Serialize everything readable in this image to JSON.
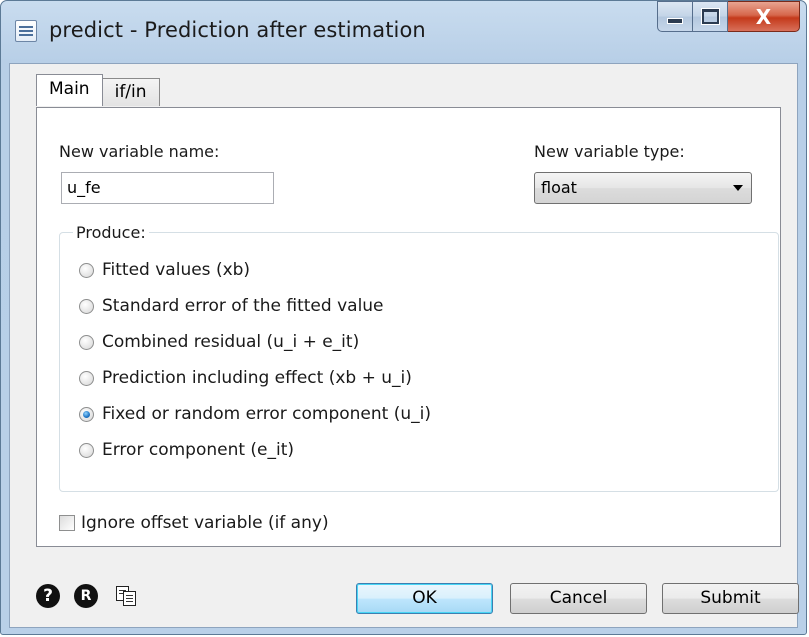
{
  "window": {
    "title": "predict - Prediction after estimation",
    "close_glyph": "X"
  },
  "tabs": [
    {
      "label": "Main",
      "active": true
    },
    {
      "label": "if/in",
      "active": false
    }
  ],
  "main": {
    "new_var_name_label": "New variable name:",
    "new_var_name_value": "u_fe",
    "new_var_type_label": "New variable type:",
    "new_var_type_value": "float",
    "produce_label": "Produce:",
    "options": [
      {
        "label": "Fitted values (xb)",
        "checked": false
      },
      {
        "label": "Standard error of the fitted value",
        "checked": false
      },
      {
        "label": "Combined residual (u_i + e_it)",
        "checked": false
      },
      {
        "label": "Prediction including effect (xb + u_i)",
        "checked": false
      },
      {
        "label": "Fixed or random error component (u_i)",
        "checked": true
      },
      {
        "label": "Error component (e_it)",
        "checked": false
      }
    ],
    "ignore_offset_label": "Ignore offset variable (if any)",
    "ignore_offset_checked": false
  },
  "footer": {
    "help_glyph": "?",
    "reset_glyph": "R",
    "ok_label": "OK",
    "cancel_label": "Cancel",
    "submit_label": "Submit"
  },
  "icons": [
    "dialog-app-icon",
    "minimize-icon",
    "maximize-icon",
    "close-icon",
    "help-icon",
    "reset-icon",
    "copy-command-icon",
    "dropdown-arrow-icon"
  ]
}
